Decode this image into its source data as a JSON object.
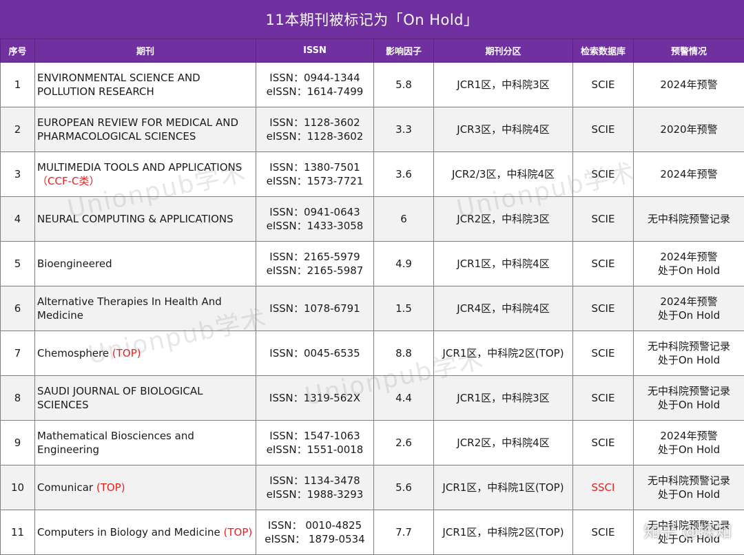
{
  "title": "11本期刊被标记为「On Hold」",
  "headers": [
    "序号",
    "期刊",
    "ISSN",
    "影响因子",
    "期刊分区",
    "检索数据库",
    "预警情况"
  ],
  "rows": [
    {
      "no": "1",
      "name": "ENVIRONMENTAL SCIENCE AND POLLUTION RESEARCH",
      "tag": "",
      "issn": "ISSN：0944-1344",
      "eissn": "eISSN：1614-7499",
      "if": "5.8",
      "zone": "JCR1区，中科院3区",
      "db": "SCIE",
      "db_red": false,
      "warn1": "2024年预警",
      "warn2": ""
    },
    {
      "no": "2",
      "name": "EUROPEAN REVIEW FOR MEDICAL AND PHARMACOLOGICAL SCIENCES",
      "tag": "",
      "issn": "ISSN：1128-3602",
      "eissn": "eISSN：1128-3602",
      "if": "3.3",
      "zone": "JCR3区，中科院4区",
      "db": "SCIE",
      "db_red": false,
      "warn1": "2020年预警",
      "warn2": ""
    },
    {
      "no": "3",
      "name": "MULTIMEDIA TOOLS AND APPLICATIONS",
      "tag": "（CCF-C类）",
      "issn": "ISSN：1380-7501",
      "eissn": "eISSN：1573-7721",
      "if": "3.6",
      "zone": "JCR2/3区，中科院4区",
      "db": "SCIE",
      "db_red": false,
      "warn1": "2024年预警",
      "warn2": ""
    },
    {
      "no": "4",
      "name": "NEURAL COMPUTING & APPLICATIONS",
      "tag": "",
      "issn": "ISSN：0941-0643",
      "eissn": "eISSN：1433-3058",
      "if": "6",
      "zone": "JCR2区，中科院3区",
      "db": "SCIE",
      "db_red": false,
      "warn1": "无中科院预警记录",
      "warn2": ""
    },
    {
      "no": "5",
      "name": "Bioengineered",
      "tag": "",
      "issn": "ISSN：2165-5979",
      "eissn": "eISSN：2165-5987",
      "if": "4.9",
      "zone": "JCR1区，中科院4区",
      "db": "SCIE",
      "db_red": false,
      "warn1": "2024年预警",
      "warn2": "处于On Hold"
    },
    {
      "no": "6",
      "name": "Alternative Therapies In Health And Medicine",
      "tag": "",
      "issn": "ISSN：1078-6791",
      "eissn": "",
      "if": "1.5",
      "zone": "JCR4区，中科院4区",
      "db": "SCIE",
      "db_red": false,
      "warn1": "2024年预警",
      "warn2": "处于On Hold"
    },
    {
      "no": "7",
      "name": "Chemosphere",
      "tag": "(TOP)",
      "issn": "ISSN：0045-6535",
      "eissn": "",
      "if": "8.8",
      "zone": "JCR1区，中科院2区(TOP)",
      "db": "SCIE",
      "db_red": false,
      "warn1": "无中科院预警记录",
      "warn2": "处于On Hold"
    },
    {
      "no": "8",
      "name": "SAUDI JOURNAL OF BIOLOGICAL SCIENCES",
      "tag": "",
      "issn": "ISSN：1319-562X",
      "eissn": "",
      "if": "4.4",
      "zone": "JCR1区，中科院3区",
      "db": "SCIE",
      "db_red": false,
      "warn1": "无中科院预警记录",
      "warn2": "处于On Hold"
    },
    {
      "no": "9",
      "name": "Mathematical Biosciences and Engineering",
      "tag": "",
      "issn": "ISSN：1547-1063",
      "eissn": "eISSN：1551-0018",
      "if": "2.6",
      "zone": "JCR2区，中科院4区",
      "db": "SCIE",
      "db_red": false,
      "warn1": "2024年预警",
      "warn2": "处于On Hold"
    },
    {
      "no": "10",
      "name": "Comunicar",
      "tag": "(TOP)",
      "issn": "ISSN：1134-3478",
      "eissn": "eISSN：1988-3293",
      "if": "5.6",
      "zone": "JCR1区，中科院1区(TOP)",
      "db": "SSCI",
      "db_red": true,
      "warn1": "无中科院预警记录",
      "warn2": "处于On Hold"
    },
    {
      "no": "11",
      "name": "Computers in Biology and Medicine",
      "tag": "(TOP)",
      "issn": "ISSN： 0010-4825",
      "eissn": "eISSN： 1879-0534",
      "if": "7.7",
      "zone": "JCR1区，中科院2区(TOP)",
      "db": "SCIE",
      "db_red": false,
      "warn1": "无中科院预警记录",
      "warn2": "处于On Hold"
    }
  ],
  "watermark": "Unionpub学术",
  "corner_watermark": "知乎 @探知",
  "colors": {
    "header": "#7030a0",
    "accent_red": "#e8201c",
    "alt_row": "#f2f2f2"
  }
}
